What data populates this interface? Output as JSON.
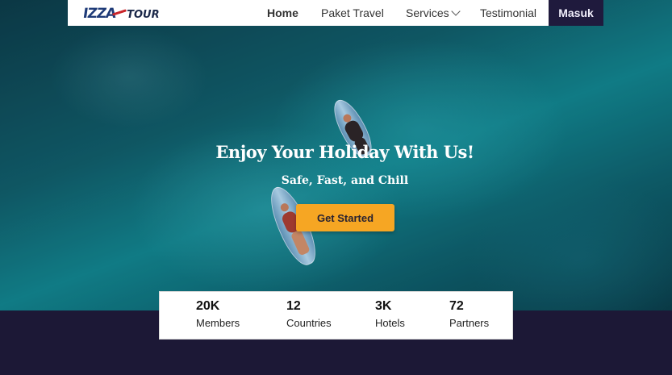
{
  "brand": {
    "logo_main": "IZZA",
    "logo_sub": "TOUR"
  },
  "nav": {
    "items": [
      {
        "label": "Home",
        "active": true
      },
      {
        "label": "Paket Travel"
      },
      {
        "label": "Services",
        "icon": "chevron-down-icon"
      },
      {
        "label": "Testimonial"
      }
    ],
    "login_label": "Masuk"
  },
  "hero": {
    "title": "Enjoy Your Holiday With Us!",
    "subtitle": "Safe, Fast, and Chill",
    "cta_label": "Get Started"
  },
  "stats": [
    {
      "value": "20K",
      "label": "Members"
    },
    {
      "value": "12",
      "label": "Countries"
    },
    {
      "value": "3K",
      "label": "Hotels"
    },
    {
      "value": "72",
      "label": "Partners"
    }
  ],
  "colors": {
    "accent": "#f6a623",
    "dark": "#1f1a3d",
    "footer_bg": "#1c1836",
    "logo_blue": "#1f3b78",
    "logo_red": "#c9262b"
  }
}
